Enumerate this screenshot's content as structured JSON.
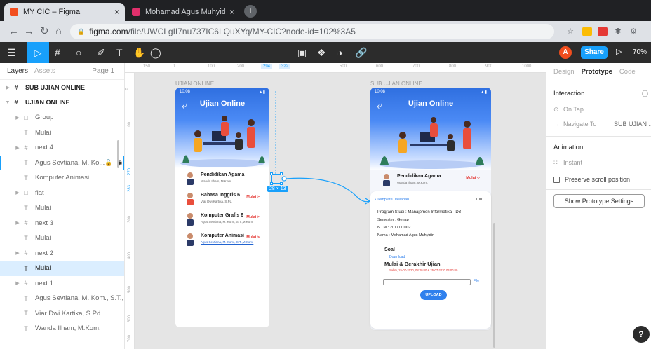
{
  "browser": {
    "tabs": [
      {
        "title": "MY CIC – Figma",
        "close": "×"
      },
      {
        "title": "Mohamad Agus Muhyidin (@mu",
        "close": "×"
      }
    ],
    "new_tab": "+",
    "url_host": "figma.com",
    "url_path": "/file/UWCLgII7nu737IC6LQuXYq/MY-CIC?node-id=102%3A5"
  },
  "figma": {
    "avatar_letter": "A",
    "share_label": "Share",
    "zoom": "70%",
    "layers_tab": "Layers",
    "assets_tab": "Assets",
    "page_label": "Page 1",
    "layers": [
      {
        "label": "SUB UJIAN ONLINE",
        "kind": "frame"
      },
      {
        "label": "UJIAN ONLINE",
        "kind": "frame"
      },
      {
        "label": "Group",
        "kind": "group"
      },
      {
        "label": "Mulai",
        "kind": "text"
      },
      {
        "label": "next 4",
        "kind": "frame-child"
      },
      {
        "label": "Agus Sevtiana, M. Ko...",
        "kind": "text"
      },
      {
        "label": "Komputer Animasi",
        "kind": "text"
      },
      {
        "label": "flat",
        "kind": "group"
      },
      {
        "label": "Mulai",
        "kind": "text"
      },
      {
        "label": "next 3",
        "kind": "frame-child"
      },
      {
        "label": "Mulai",
        "kind": "text"
      },
      {
        "label": "next 2",
        "kind": "frame-child"
      },
      {
        "label": "Mulai",
        "kind": "text"
      },
      {
        "label": "next 1",
        "kind": "frame-child"
      },
      {
        "label": "Agus Sevtiana, M. Kom., S.T.,...",
        "kind": "text"
      },
      {
        "label": "Viar Dwi Kartika, S.Pd.",
        "kind": "text"
      },
      {
        "label": "Wanda Ilham, M.Kom.",
        "kind": "text"
      }
    ],
    "ruler_h": [
      "150",
      "0",
      "100",
      "200",
      "294",
      "322",
      "500",
      "600",
      "700",
      "800",
      "900",
      "1000"
    ],
    "ruler_v": [
      "0",
      "100",
      "270",
      "283",
      "300",
      "400",
      "500",
      "600",
      "700"
    ],
    "frame1_label": "UJIAN ONLINE",
    "frame2_label": "SUB UJIAN ONLINE",
    "size_badge": "28 × 13",
    "right_tabs": [
      "Design",
      "Prototype",
      "Code"
    ],
    "interaction_label": "Interaction",
    "on_tap": "On Tap",
    "navigate_to": "Navigate To",
    "navigate_target": "SUB UJIAN ...",
    "animation_label": "Animation",
    "instant": "Instant",
    "preserve_scroll": "Preserve scroll position",
    "proto_settings": "Show Prototype Settings",
    "help": "?"
  },
  "app": {
    "time": "10:08",
    "title": "Ujian Online",
    "courses": [
      {
        "name": "Pendidikan Agama",
        "teacher": "Wanda Ilham, M.Kom.",
        "action": "Mulai >"
      },
      {
        "name": "Bahasa Inggris 6",
        "teacher": "Viar Dwi Kartika, S.Pd.",
        "action": "Mulai >"
      },
      {
        "name": "Komputer Grafis 6",
        "teacher": "Agus Sevtiana, M. Kom., S.T.,M.Kom.",
        "action": "Mulai >"
      },
      {
        "name": "Komputer Animasi",
        "teacher": "Agus Sevtiana, M. Kom., S.T.,M.Kom.",
        "action": "Mulai >"
      }
    ],
    "detail_course": {
      "name": "Pendidikan Agama",
      "teacher": "Wanda Ilham, M.Kom.",
      "action": "Mulai ⌵"
    },
    "template_link": "• Template Jawaban",
    "code": "1001",
    "prodi": "Program Studi  :  Manajemen Informatika - D3",
    "semester": "Semester    :  Genap",
    "nim": "N I M           :  2017111002",
    "nama": "Nama           :  Mohamad Agus Muhyidin",
    "soal": "Soal",
    "download": "Download",
    "schedule_title": "Mulai & Berakhir Ujian",
    "schedule": "Sabtu, 25-07-2020, 08:00:00  &  25-07-2020 04:00:00",
    "file_label": "File",
    "upload": "UPLOAD"
  }
}
